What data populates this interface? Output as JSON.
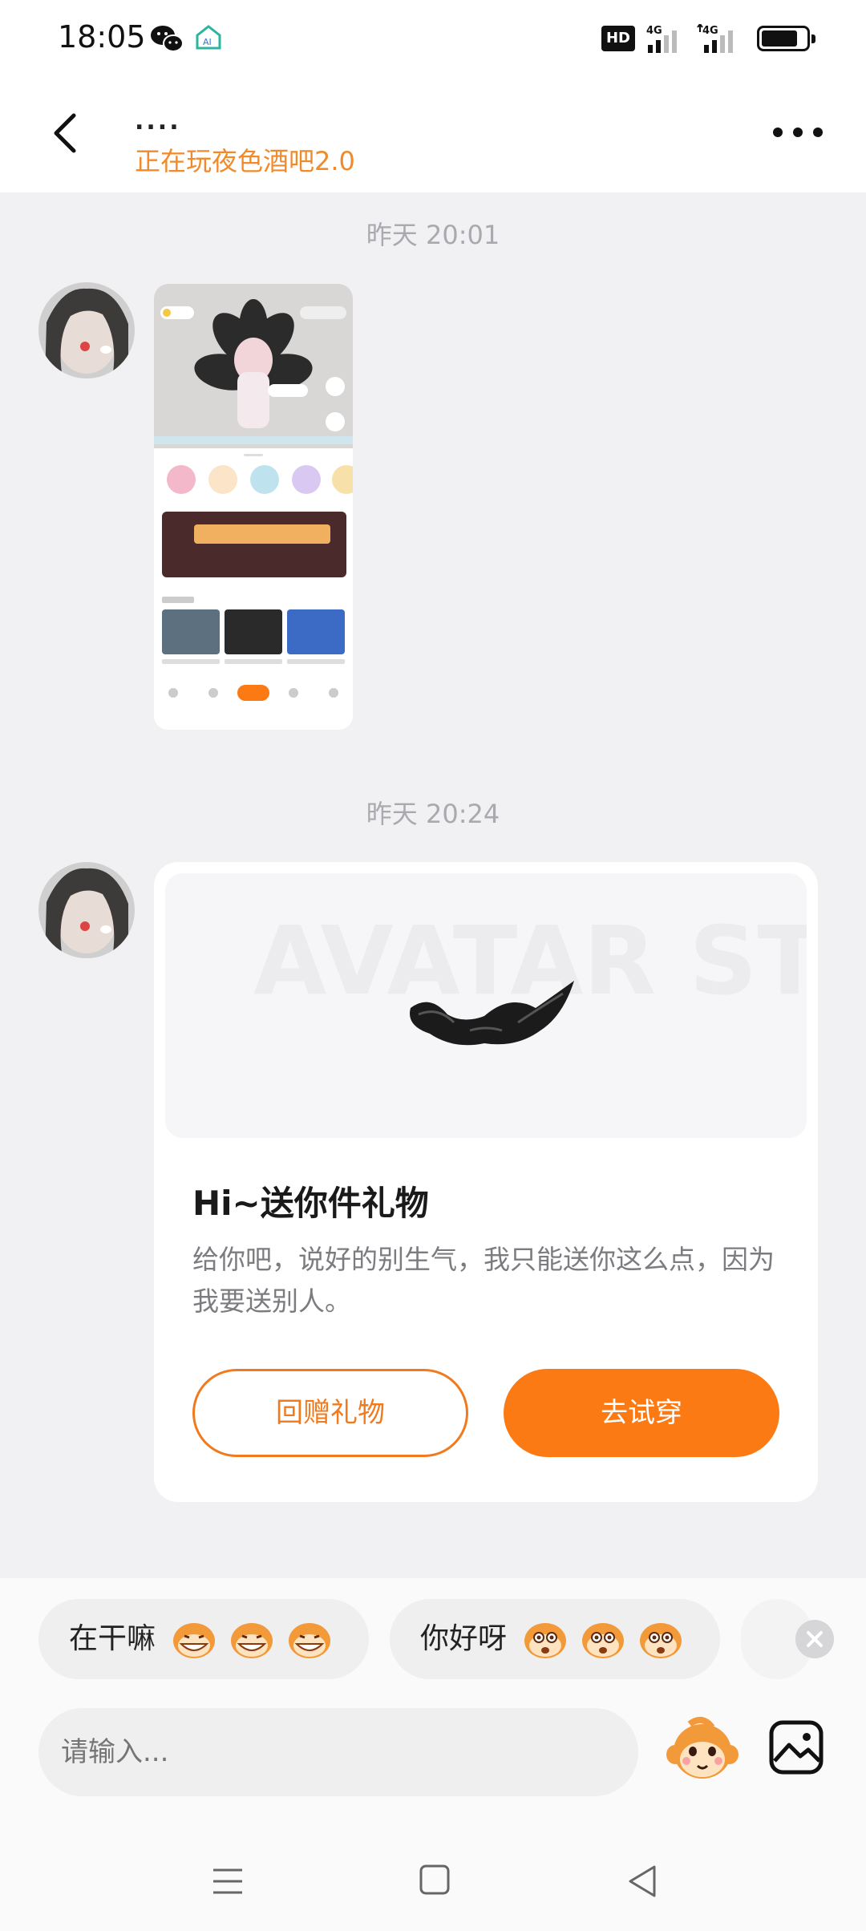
{
  "status_bar": {
    "time": "18:05",
    "icons": [
      "wechat-icon",
      "home-ai-icon",
      "hd-icon",
      "signal-4g-icon",
      "signal-4g-icon",
      "battery-icon"
    ],
    "hd_label": "HD",
    "network": "4G"
  },
  "header": {
    "name": "....",
    "status": "正在玩夜色酒吧2.0"
  },
  "messages": [
    {
      "timestamp": "昨天 20:01",
      "type": "image"
    },
    {
      "timestamp": "昨天 20:24",
      "type": "gift",
      "banner_text": "AVATAR STORE",
      "title": "Hi~送你件礼物",
      "description": "给你吧，说好的别生气，我只能送你这么点，因为我要送别人。",
      "return_label": "回赠礼物",
      "try_label": "去试穿",
      "accent": "#fb7a14"
    }
  ],
  "quick_replies": [
    {
      "text": "在干嘛"
    },
    {
      "text": "你好呀"
    }
  ],
  "input": {
    "placeholder": "请输入..."
  }
}
